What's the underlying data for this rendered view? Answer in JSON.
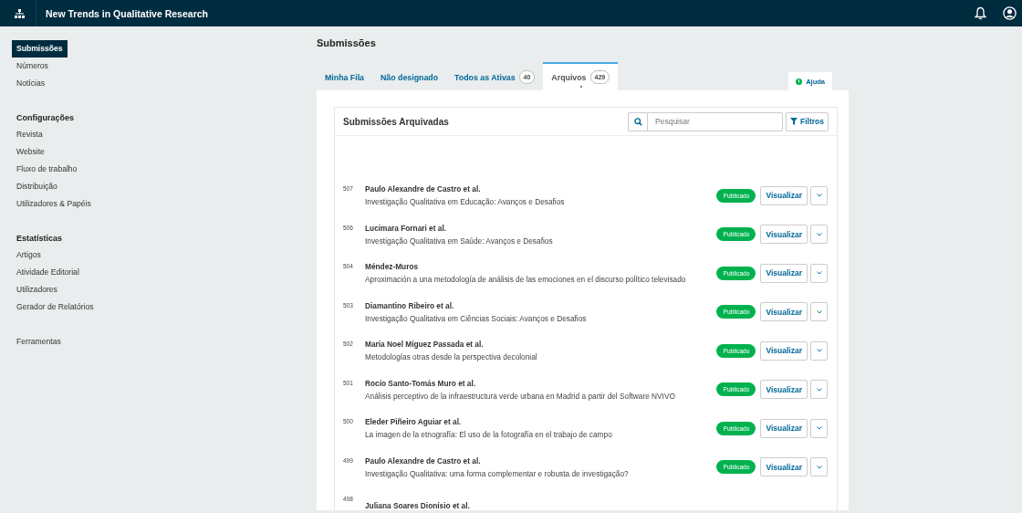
{
  "header": {
    "title": "New Trends in Qualitative Research"
  },
  "sidebar": {
    "sections": [
      {
        "items": [
          {
            "label": "Submissões",
            "selected": true
          },
          {
            "label": "Números",
            "selected": false
          },
          {
            "label": "Notícias",
            "selected": false
          }
        ]
      },
      {
        "heading": "Configurações",
        "items": [
          {
            "label": "Revista",
            "selected": false
          },
          {
            "label": "Website",
            "selected": false
          },
          {
            "label": "Fluxo de trabalho",
            "selected": false
          },
          {
            "label": "Distribuição",
            "selected": false
          },
          {
            "label": "Utilizadores & Papéis",
            "selected": false
          }
        ]
      },
      {
        "heading": "Estatísticas",
        "items": [
          {
            "label": "Artigos",
            "selected": false
          },
          {
            "label": "Atividade Editorial",
            "selected": false
          },
          {
            "label": "Utilizadores",
            "selected": false
          },
          {
            "label": "Gerador de Relatórios",
            "selected": false
          }
        ]
      },
      {
        "items": [
          {
            "label": "Ferramentas",
            "selected": false
          }
        ]
      }
    ]
  },
  "page_title": "Submissões",
  "tabs": [
    {
      "label": "Minha Fila",
      "selected": false
    },
    {
      "label": "Não designado",
      "selected": false
    },
    {
      "label": "Todos as Ativas",
      "count": "40",
      "selected": false
    },
    {
      "label": "Arquivos",
      "count": "429",
      "selected": true
    }
  ],
  "help_button": "Ajuda",
  "panel": {
    "title": "Submissões Arquivadas",
    "search": {
      "placeholder": "Pesquisar"
    },
    "filter_button": "Filtros"
  },
  "rows": [
    {
      "id": "507",
      "authors": "Paulo Alexandre de Castro et al.",
      "title": "Investigação Qualitativa em Educação: Avanços e Desafios",
      "status": "Publicado",
      "action": "Visualizar"
    },
    {
      "id": "506",
      "authors": "Lucimara Fornari et al.",
      "title": "Investigação Qualitativa em Saúde: Avanços e Desafios",
      "status": "Publicado",
      "action": "Visualizar"
    },
    {
      "id": "504",
      "authors": "Méndez-Muros",
      "title": "Aproximación a una metodología de análisis de las emociones en el discurso político televisado",
      "status": "Publicado",
      "action": "Visualizar"
    },
    {
      "id": "503",
      "authors": "Diamantino Ribeiro et al.",
      "title": "Investigação Qualitativa em Ciências Sociais: Avanços e Desafios",
      "status": "Publicado",
      "action": "Visualizar"
    },
    {
      "id": "502",
      "authors": "María Noel Míguez Passada et al.",
      "title": "Metodologías otras desde la perspectiva decolonial",
      "status": "Publicado",
      "action": "Visualizar"
    },
    {
      "id": "501",
      "authors": "Rocío Santo-Tomás Muro et al.",
      "title": "Análisis perceptivo de la infraestructura verde urbana en Madrid a partir del Software NVIVO",
      "status": "Publicado",
      "action": "Visualizar"
    },
    {
      "id": "500",
      "authors": "Eleder Piñeiro Aguiar et al.",
      "title": "La imagen de la etnografía: El uso de la fotografía en el trabajo de campo",
      "status": "Publicado",
      "action": "Visualizar"
    },
    {
      "id": "499",
      "authors": "Paulo Alexandre de Castro et al.",
      "title": "Investigação Qualitativa: uma forma complementar e robusta de investigação?",
      "status": "Publicado",
      "action": "Visualizar"
    },
    {
      "id": "498",
      "authors": "Juliana Soares Dionísio et al."
    }
  ]
}
